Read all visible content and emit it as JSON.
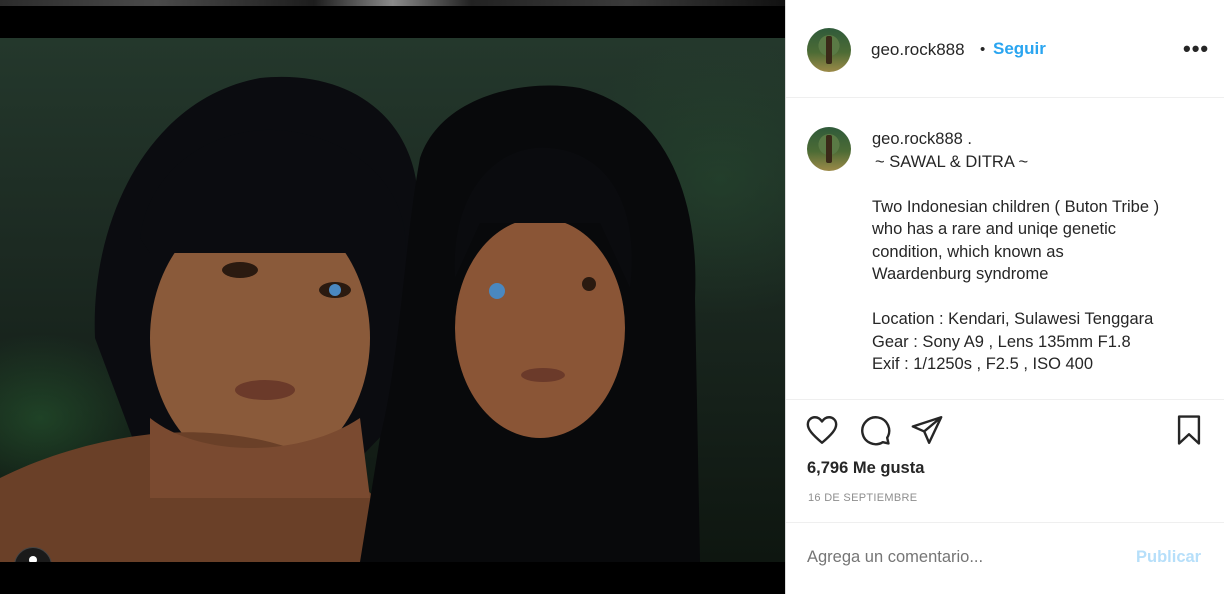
{
  "post": {
    "username": "geo.rock888",
    "separator": "•",
    "follow_label": "Seguir",
    "more_icon": "more-horizontal-icon",
    "caption_username": "geo.rock888 .",
    "caption_lines": [
      "~ SAWAL & DITRA ~",
      "",
      "Two Indonesian children ( Buton Tribe )",
      "who has a rare and uniqe genetic",
      "condition, which known as",
      "Waardenburg syndrome",
      "",
      "Location : Kendari, Sulawesi Tenggara",
      "Gear : Sony A9 , Lens 135mm F1.8",
      "Exif : 1/1250s , F2.5 , ISO 400"
    ],
    "likes_text": "6,796 Me gusta",
    "date_text": "16 DE SEPTIEMBRE",
    "comment_placeholder": "Agrega un comentario...",
    "publish_label": "Publicar"
  },
  "icons": {
    "like": "heart-icon",
    "comment": "comment-icon",
    "share": "send-icon",
    "save": "bookmark-icon",
    "tag": "user-tag-icon"
  },
  "colors": {
    "accent": "#2aa5f0",
    "publish_disabled": "#b6dffa",
    "text": "#262626",
    "muted": "#8e8e8e"
  }
}
